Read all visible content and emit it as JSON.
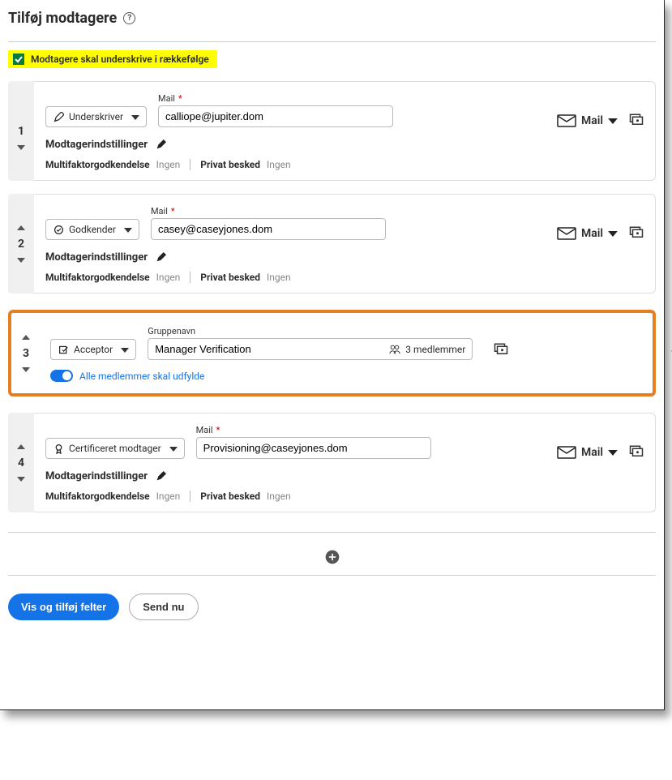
{
  "title": "Tilføj modtagere",
  "order_checkbox_label": "Modtagere skal underskrive i rækkefølge",
  "labels": {
    "mail": "Mail",
    "gruppenavn": "Gruppenavn",
    "modtagerindstillinger": "Modtagerindstillinger",
    "multifaktor": "Multifaktorgodkendelse",
    "privat": "Privat besked",
    "ingen": "Ingen",
    "mail_dropdown": "Mail"
  },
  "recipients": [
    {
      "index": "1",
      "role": "Underskriver",
      "email": "calliope@jupiter.dom",
      "show_mail_dropdown": true,
      "show_settings": true
    },
    {
      "index": "2",
      "role": "Godkender",
      "email": "casey@caseyjones.dom",
      "show_mail_dropdown": true,
      "show_settings": true
    },
    {
      "index": "3",
      "role": "Acceptor",
      "is_group": true,
      "group_name": "Manager Verification",
      "members_label": "3 medlemmer",
      "toggle_label": "Alle medlemmer skal udfylde",
      "highlighted": true
    },
    {
      "index": "4",
      "role": "Certificeret modtager",
      "email": "Provisioning@caseyjones.dom",
      "show_mail_dropdown": true,
      "show_settings": true
    }
  ],
  "buttons": {
    "primary": "Vis og tilføj felter",
    "secondary": "Send nu"
  }
}
